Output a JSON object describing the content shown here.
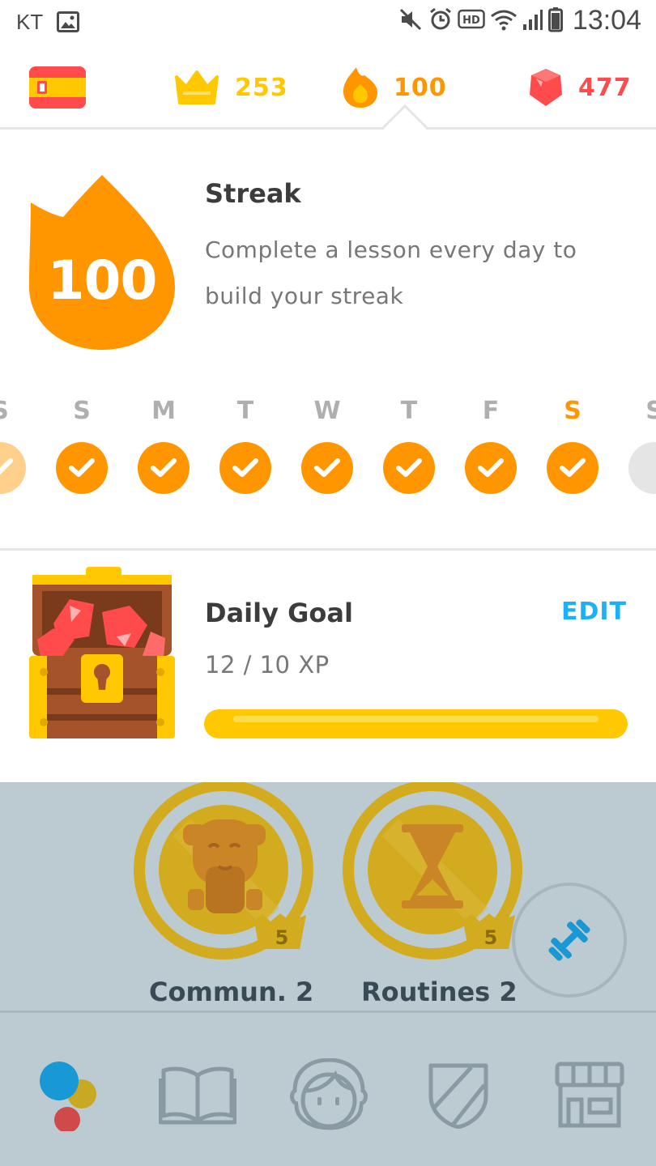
{
  "status_bar": {
    "carrier": "KT",
    "time": "13:04",
    "hd": "HD"
  },
  "stats": {
    "crowns": "253",
    "streak": "100",
    "gems": "477"
  },
  "streak": {
    "count": "100",
    "title": "Streak",
    "description": "Complete a lesson every day to build your streak",
    "days": [
      {
        "label": "S",
        "done": true,
        "faded": true
      },
      {
        "label": "S",
        "done": true
      },
      {
        "label": "M",
        "done": true
      },
      {
        "label": "T",
        "done": true
      },
      {
        "label": "W",
        "done": true
      },
      {
        "label": "T",
        "done": true
      },
      {
        "label": "F",
        "done": true
      },
      {
        "label": "S",
        "done": true,
        "today": true
      },
      {
        "label": "S",
        "done": false
      }
    ]
  },
  "daily_goal": {
    "title": "Daily Goal",
    "edit": "EDIT",
    "xp": "12 / 10 XP",
    "progress": 1.0
  },
  "skills": [
    {
      "label": "Commun. 2",
      "level": "5",
      "icon": "bust-icon"
    },
    {
      "label": "Routines 2",
      "level": "5",
      "icon": "hourglass-icon"
    }
  ],
  "nav": [
    {
      "name": "nav-home",
      "icon": "dots-icon"
    },
    {
      "name": "nav-stories",
      "icon": "book-icon"
    },
    {
      "name": "nav-profile",
      "icon": "avatar-icon"
    },
    {
      "name": "nav-leaderboard",
      "icon": "shield-icon"
    },
    {
      "name": "nav-shop",
      "icon": "shop-icon"
    }
  ],
  "colors": {
    "orange": "#ff9600",
    "gold": "#ffc800",
    "red": "#ff4b4b",
    "blue": "#1cb0f6",
    "dim_overlay": "#bccbd1"
  }
}
